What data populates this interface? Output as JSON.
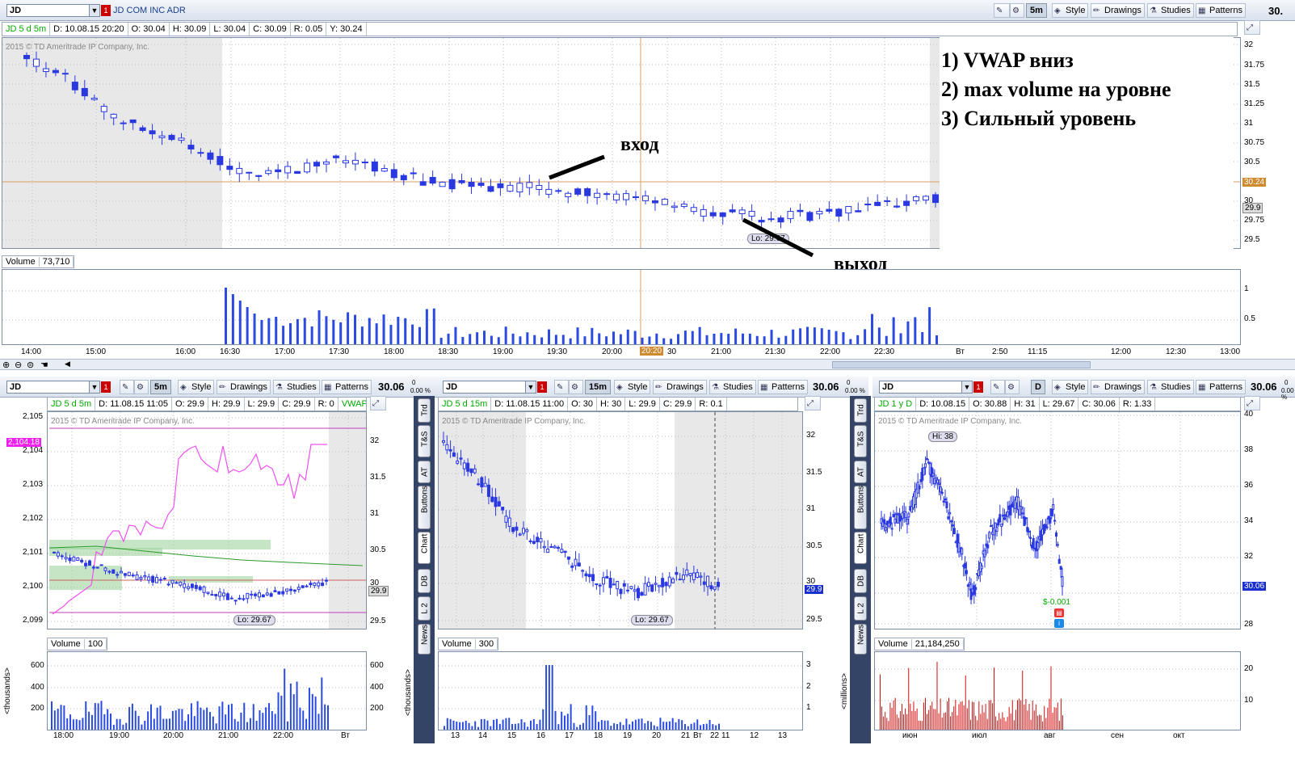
{
  "top": {
    "symbol": "JD",
    "alert": "1",
    "company": "JD COM INC ADR",
    "timeframe": "5m",
    "buttons": {
      "style": "Style",
      "drawings": "Drawings",
      "studies": "Studies",
      "patterns": "Patterns"
    },
    "last_price": "30.",
    "header": [
      "JD 5 d 5m",
      "D: 10.08.15 20:20",
      "O: 30.04",
      "H: 30.09",
      "L: 30.04",
      "C: 30.09",
      "R: 0.05",
      "Y: 30.24"
    ],
    "copyright": "2015 © TD Ameritrade IP Company, Inc.",
    "y_ticks": [
      "32",
      "31.75",
      "31.5",
      "31.25",
      "31",
      "30.75",
      "30.5",
      "30.24",
      "30",
      "29.9",
      "29.75",
      "29.5"
    ],
    "cursor_tag": "30.24",
    "price_tag": "29.9",
    "lo_label": "Lo: 29.67",
    "volume_label": "Volume",
    "volume_value": "73,710",
    "vol_ticks": [
      "1",
      "0.5"
    ],
    "x_ticks": [
      "14:00",
      "15:00",
      "16:00",
      "16:30",
      "17:00",
      "17:30",
      "18:00",
      "18:30",
      "19:00",
      "19:30",
      "20:00",
      "20:20",
      "30",
      "21:00",
      "21:30",
      "22:00",
      "22:30",
      "Вт",
      "2:50",
      "11:15",
      "12:00",
      "12:30",
      "13:00"
    ],
    "annotations": {
      "line1": "1) VWAP вниз",
      "line2": "2) max volume на уровне",
      "line3": "3) Сильный уровень",
      "entry": "вход",
      "exit": "выход"
    }
  },
  "bottom_left": {
    "symbol": "JD",
    "alert": "1",
    "timeframe": "5m",
    "buttons": {
      "style": "Style",
      "drawings": "Drawings",
      "studies": "Studies",
      "patterns": "Patterns"
    },
    "last_price": "30.06",
    "pct_top": "0",
    "pct_bottom": "0.00 %",
    "header": [
      "JD 5 d 5m",
      "D: 11.08.15 11:05",
      "O: 29.9",
      "H: 29.9",
      "L: 29.9",
      "C: 29.9",
      "R: 0",
      "VWAP"
    ],
    "copyright": "2015 © TD Ameritrade IP Company, Inc.",
    "left_ticks": [
      "2,105",
      "2,104",
      "2,103",
      "2,102",
      "2,101",
      "2,100",
      "2,099"
    ],
    "left_tag": "2,104.18",
    "right_ticks": [
      "32",
      "31.5",
      "31",
      "30.5",
      "30",
      "29.5"
    ],
    "price_tag": "29.9",
    "lo_label": "Lo: 29.67",
    "volume_label": "Volume",
    "volume_value": "100",
    "vol_ticks": [
      "600",
      "400",
      "200"
    ],
    "vol_axis_label": "<thousands>",
    "x_ticks": [
      "18:00",
      "19:00",
      "20:00",
      "21:00",
      "22:00",
      "Вт"
    ]
  },
  "bottom_mid": {
    "symbol": "JD",
    "alert": "1",
    "timeframe": "15m",
    "buttons": {
      "style": "Style",
      "drawings": "Drawings",
      "studies": "Studies",
      "patterns": "Patterns"
    },
    "last_price": "30.06",
    "pct_top": "0",
    "pct_bottom": "0.00 %",
    "header": [
      "JD 5 d 15m",
      "D: 11.08.15 11:00",
      "O: 30",
      "H: 30",
      "L: 29.9",
      "C: 29.9",
      "R: 0.1"
    ],
    "copyright": "2015 © TD Ameritrade IP Company, Inc.",
    "right_ticks": [
      "32",
      "31.5",
      "31",
      "30.5",
      "30",
      "29.5"
    ],
    "price_tag": "29.9",
    "lo_label": "Lo: 29.67",
    "volume_label": "Volume",
    "volume_value": "300",
    "vol_ticks": [
      "3",
      "2",
      "1"
    ],
    "vol_axis_label": "<thousands>",
    "x_ticks": [
      "13",
      "14",
      "15",
      "16",
      "17",
      "18",
      "19",
      "20",
      "21",
      "22",
      "Вт",
      "11",
      "12",
      "13"
    ],
    "side_tabs": [
      "Trd",
      "T&S",
      "AT",
      "Buttons",
      "Chart",
      "DB",
      "L 2",
      "News"
    ]
  },
  "bottom_right": {
    "symbol": "JD",
    "alert": "1",
    "timeframe": "D",
    "buttons": {
      "style": "Style",
      "drawings": "Drawings",
      "studies": "Studies",
      "patterns": "Patterns"
    },
    "last_price": "30.06",
    "pct_top": "0",
    "pct_bottom": "0.00 %",
    "header": [
      "JD 1 y D",
      "D: 10.08.15",
      "O: 30.88",
      "H: 31",
      "L: 29.67",
      "C: 30.06",
      "R: 1.33"
    ],
    "copyright": "2015 © TD Ameritrade IP Company, Inc.",
    "right_ticks": [
      "40",
      "38",
      "36",
      "34",
      "32",
      "30",
      "28"
    ],
    "price_tag": "30.06",
    "hi_label": "Hi: 38",
    "change_label": "$-0.001",
    "volume_label": "Volume",
    "volume_value": "21,184,250",
    "vol_ticks": [
      "20",
      "10"
    ],
    "vol_axis_label": "<millions>",
    "x_ticks": [
      "июн",
      "июл",
      "авг",
      "сен",
      "окт"
    ],
    "side_tabs": [
      "Trd",
      "T&S",
      "AT",
      "Buttons",
      "Chart",
      "DB",
      "L 2",
      "News"
    ]
  }
}
